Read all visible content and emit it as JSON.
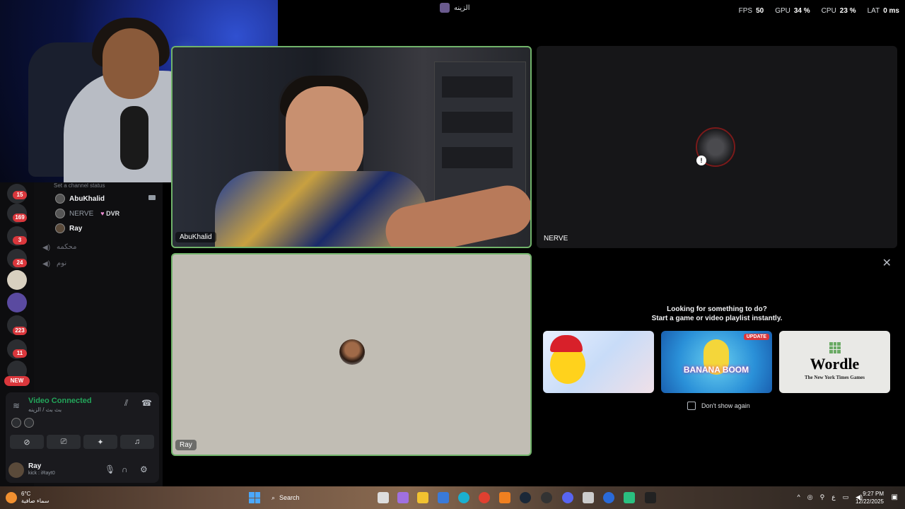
{
  "topbar": {
    "server_name": "الزينه",
    "stats": [
      {
        "label": "FPS",
        "value": "50"
      },
      {
        "label": "GPU",
        "value": "34 %"
      },
      {
        "label": "CPU",
        "value": "23 %"
      },
      {
        "label": "LAT",
        "value": "0 ms"
      }
    ]
  },
  "rail": {
    "badges": [
      "15",
      "169",
      "3",
      "24",
      "223",
      "11"
    ],
    "new_label": "NEW"
  },
  "channels": {
    "status_hint": "Set a channel status",
    "members": [
      {
        "name": "AbuKhalid"
      },
      {
        "name": "NERVE",
        "tag": "DVR"
      },
      {
        "name": "Ray"
      }
    ],
    "voice_channels": [
      "محكمه",
      "نوم"
    ]
  },
  "voice_panel": {
    "status": "Video Connected",
    "location": "بث بث / الزينه",
    "user_name": "Ray",
    "user_status": "kick : iRayt0"
  },
  "stage": {
    "tiles": [
      {
        "label": "AbuKhalid"
      },
      {
        "label": "NERVE"
      },
      {
        "label": "Ray"
      }
    ]
  },
  "activity": {
    "title": "Looking for something to do?",
    "subtitle": "Start a game or video playlist instantly.",
    "games": [
      {
        "name": "chick-game"
      },
      {
        "name": "BANANA BOOM",
        "badge": "UPDATE"
      },
      {
        "name": "Wordle",
        "publisher": "The New York Times Games"
      }
    ],
    "dont_show": "Don't show again"
  },
  "taskbar": {
    "weather_temp": "6°C",
    "weather_desc": "سماء صافية",
    "search_placeholder": "Search",
    "time": "9:27 PM",
    "date": "12/22/2025"
  },
  "colors": {
    "speaking_border": "#71b36a",
    "connected_green": "#23a55a",
    "badge_red": "#da373c"
  }
}
